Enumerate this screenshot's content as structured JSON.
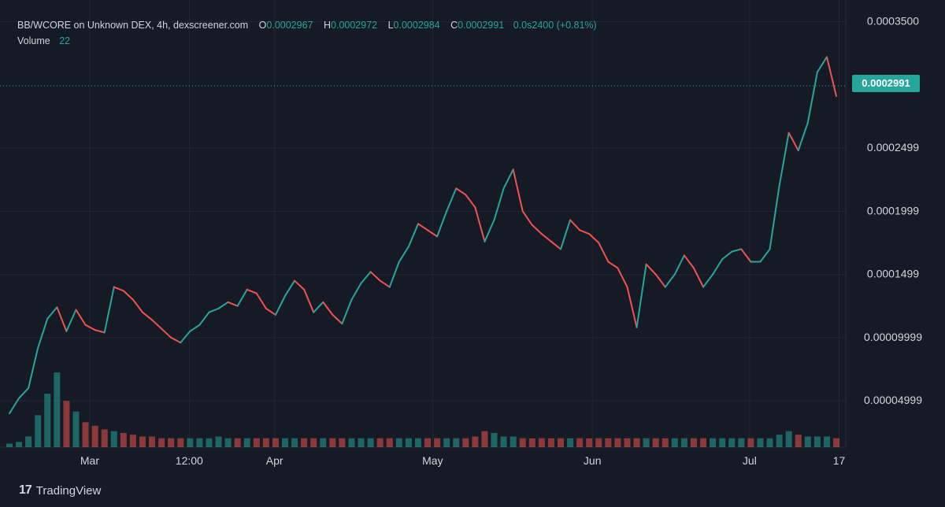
{
  "legend": {
    "title": "BB/WCORE on Unknown DEX, 4h, dexscreener.com",
    "o_label": "O",
    "o_value": "0.0002967",
    "h_label": "H",
    "h_value": "0.0002972",
    "l_label": "L",
    "l_value": "0.0002984",
    "c_label": "C",
    "c_value": "0.0002991",
    "change": "0.0s2400 (+0.81%)",
    "volume_label": "Volume",
    "volume_value": "22"
  },
  "branding": {
    "name": "TradingView",
    "mark": "17"
  },
  "chart_data": {
    "type": "line",
    "title": "BB/WCORE on Unknown DEX, 4h, dexscreener.com",
    "xlabel": "",
    "ylabel": "",
    "ylim": [
      1.33e-05,
      0.0003621
    ],
    "y_ticks": [
      "0.0003500",
      "0.0002499",
      "0.0001999",
      "0.0001499",
      "0.00009999",
      "0.00004999"
    ],
    "y_tick_values": [
      0.00035,
      0.0002499,
      0.0001999,
      0.0001499,
      9.999e-05,
      4.999e-05
    ],
    "x_ticks": [
      "Mar",
      "12:00",
      "Apr",
      "May",
      "Jun",
      "Jul",
      "17"
    ],
    "x_tick_positions": [
      0.096,
      0.215,
      0.317,
      0.506,
      0.697,
      0.885,
      0.992
    ],
    "last_price": 0.0002991,
    "last_price_label": "0.0002991",
    "grid": true,
    "colors": {
      "up": "#26a69a",
      "down": "#ef5350",
      "background": "#161a25",
      "grid": "#232632",
      "text": "#d1d4dc"
    },
    "series": [
      {
        "values": [
          4e-05,
          5.2e-05,
          6e-05,
          9.2e-05,
          0.000115,
          0.000124,
          0.000105,
          0.000122,
          0.00011,
          0.000106,
          0.000104,
          0.00014,
          0.000137,
          0.00013,
          0.00012,
          0.000114,
          0.000107,
          0.0001,
          9.6e-05,
          0.000105,
          0.00011,
          0.00012,
          0.000123,
          0.000128,
          0.000125,
          0.000138,
          0.000135,
          0.000123,
          0.000118,
          0.000133,
          0.000145,
          0.000138,
          0.00012,
          0.000128,
          0.000118,
          0.000111,
          0.00013,
          0.000143,
          0.000152,
          0.000145,
          0.00014,
          0.00016,
          0.000172,
          0.00019,
          0.000185,
          0.00018,
          0.0002,
          0.000218,
          0.000213,
          0.000203,
          0.000176,
          0.000193,
          0.000218,
          0.000233,
          0.0002,
          0.000189,
          0.000182,
          0.000176,
          0.00017,
          0.000193,
          0.000185,
          0.000182,
          0.000175,
          0.00016,
          0.000155,
          0.00014,
          0.000108,
          0.000158,
          0.00015,
          0.00014,
          0.00015,
          0.000165,
          0.000155,
          0.00014,
          0.00015,
          0.000162,
          0.000168,
          0.00017,
          0.00016,
          0.00016,
          0.00017,
          0.00022,
          0.000262,
          0.000248,
          0.00027,
          0.00031,
          0.000322,
          0.000291
        ]
      }
    ],
    "volume": {
      "label": "Volume",
      "values": [
        2,
        3,
        6,
        18,
        30,
        42,
        26,
        20,
        14,
        12,
        10,
        9,
        8,
        7,
        6,
        6,
        5,
        5,
        5,
        5,
        5,
        5,
        6,
        5,
        5,
        5,
        5,
        5,
        5,
        5,
        5,
        5,
        5,
        5,
        5,
        5,
        5,
        5,
        5,
        5,
        5,
        5,
        5,
        5,
        5,
        5,
        5,
        5,
        5,
        6,
        9,
        8,
        6,
        6,
        5,
        5,
        5,
        5,
        5,
        5,
        5,
        5,
        5,
        5,
        5,
        5,
        5,
        5,
        5,
        5,
        5,
        5,
        5,
        5,
        5,
        5,
        5,
        5,
        5,
        5,
        5,
        7,
        9,
        7,
        6,
        6,
        6,
        5
      ]
    }
  }
}
